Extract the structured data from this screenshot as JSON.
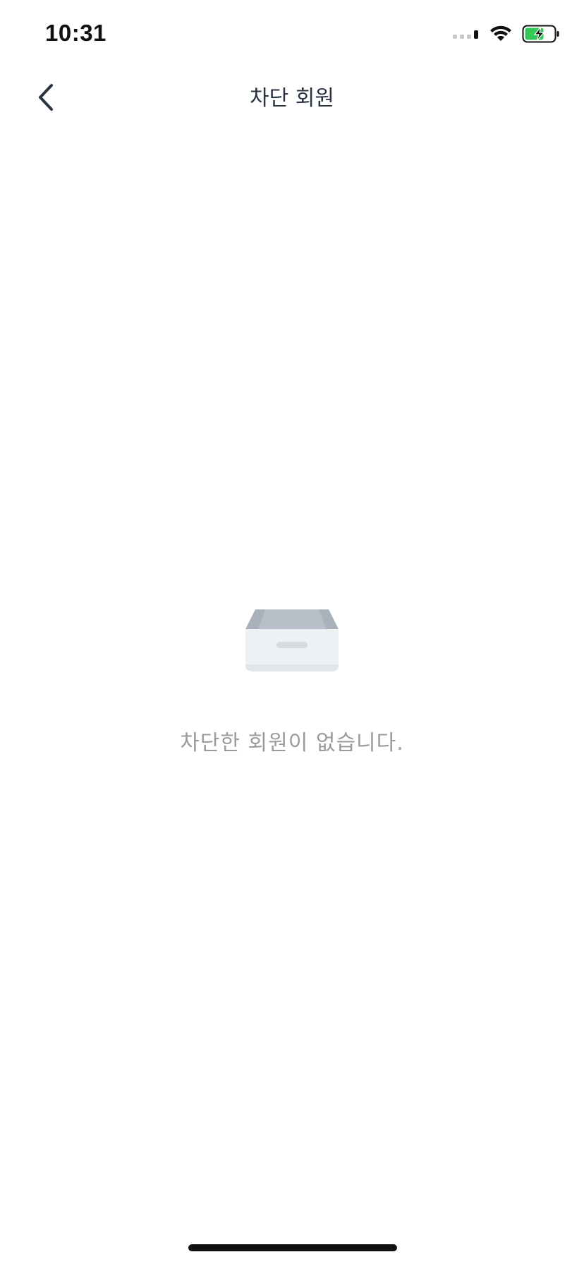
{
  "status_bar": {
    "time": "10:31",
    "icons": [
      "cellular-signal-icon",
      "wifi-icon",
      "battery-charging-icon"
    ],
    "battery_color": "#34c759"
  },
  "nav": {
    "back_icon": "chevron-left-icon",
    "title": "차단 회원"
  },
  "empty_state": {
    "icon": "empty-drawer-icon",
    "message": "차단한 회원이 없습니다."
  },
  "colors": {
    "title_text": "#2a3340",
    "muted_text": "#9b9b9b",
    "background": "#ffffff"
  }
}
